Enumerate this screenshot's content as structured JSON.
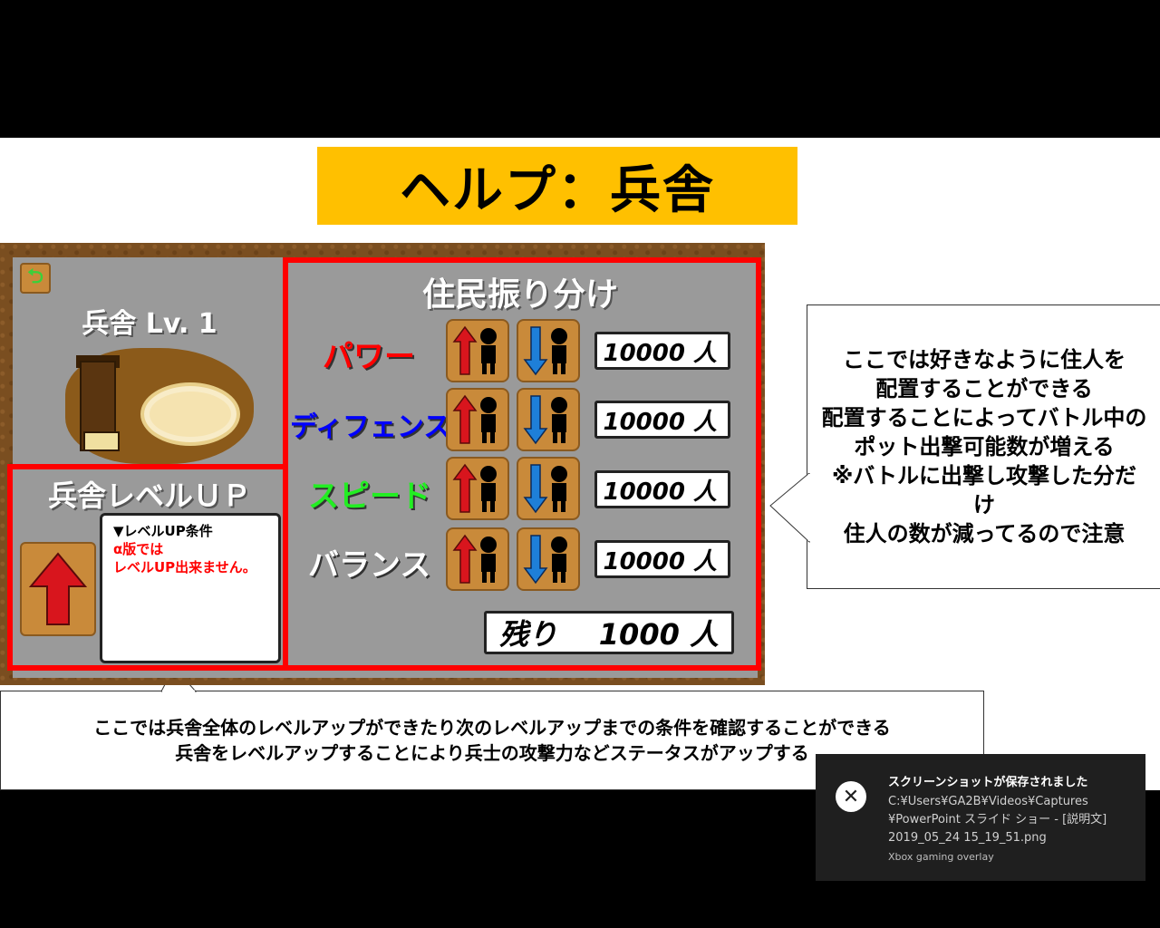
{
  "slide": {
    "title": "ヘルプ：兵舎"
  },
  "game": {
    "back_icon": "back-arrow-icon",
    "barracks_title": "兵舎 Lv. 1",
    "levelup_title": "兵舎レベルＵＰ",
    "condition_head": "▼レベルUP条件",
    "condition_line1": "α版では",
    "condition_line2": "レベルUP出来ません。",
    "alloc_title": "住民振り分け",
    "stats": [
      {
        "label": "パワー",
        "color": "#ff0000",
        "count": "10000 人"
      },
      {
        "label": "ディフェンス",
        "color": "#0000ff",
        "count": "10000 人"
      },
      {
        "label": "スピード",
        "color": "#22ee22",
        "count": "10000 人"
      },
      {
        "label": "バランス",
        "color": "#ffffff",
        "count": "10000 人"
      }
    ],
    "remain_label": "残り",
    "remain_count": "1000 人"
  },
  "callouts": {
    "right": [
      "ここでは好きなように住人を",
      "配置することができる",
      "配置することによってバトル中の",
      "ポット出撃可能数が増える",
      "※バトルに出撃し攻撃した分だ",
      "け",
      "住人の数が減ってるので注意"
    ],
    "bottom": [
      "ここでは兵舎全体のレベルアップができたり次のレベルアップまでの条件を確認することができる",
      "兵舎をレベルアップすることにより兵士の攻撃力などステータスがアップする"
    ]
  },
  "toast": {
    "title": "スクリーンショットが保存されました",
    "line1": "C:¥Users¥GA2B¥Videos¥Captures",
    "line2": "¥PowerPoint スライド ショー - [説明文]",
    "line3": "2019_05_24 15_19_51.png",
    "app": "Xbox gaming overlay"
  },
  "colors": {
    "title_bg": "#ffc000",
    "frame_red": "#ff0000",
    "panel_gray": "#9a9a9a",
    "button_orange": "#c98a3a"
  }
}
